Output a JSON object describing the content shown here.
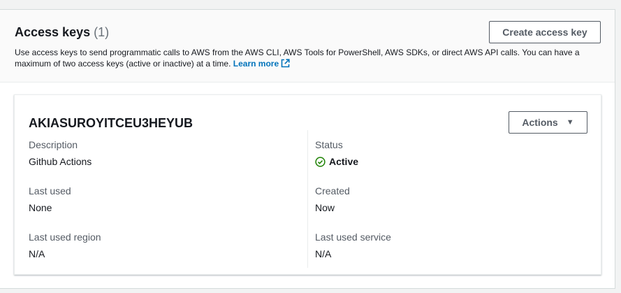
{
  "header": {
    "title": "Access keys",
    "count": "(1)",
    "create_button": "Create access key",
    "description": "Use access keys to send programmatic calls to AWS from the AWS CLI, AWS Tools for PowerShell, AWS SDKs, or direct AWS API calls. You can have a maximum of two access keys (active or inactive) at a time.",
    "learn_more": "Learn more"
  },
  "access_key": {
    "id": "AKIASUROYITCEU3HEYUB",
    "actions_button": "Actions",
    "description_label": "Description",
    "description_value": "Github Actions",
    "status_label": "Status",
    "status_value": "Active",
    "last_used_label": "Last used",
    "last_used_value": "None",
    "created_label": "Created",
    "created_value": "Now",
    "last_used_region_label": "Last used region",
    "last_used_region_value": "N/A",
    "last_used_service_label": "Last used service",
    "last_used_service_value": "N/A"
  },
  "colors": {
    "link": "#0073bb",
    "status_active": "#1d8102",
    "button_border": "#545b64"
  },
  "icons": {
    "external_link": "external-link-icon",
    "status": "check-circle-icon",
    "caret": "caret-down-icon"
  }
}
